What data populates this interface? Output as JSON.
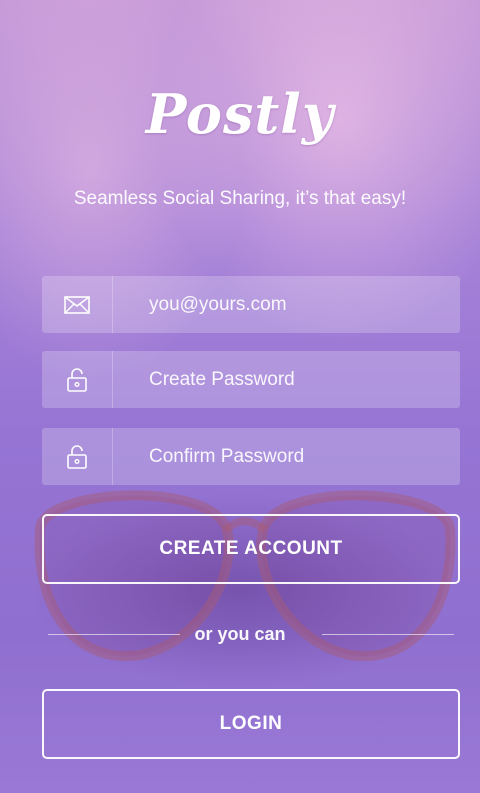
{
  "app": {
    "name": "Postly",
    "tagline": "Seamless Social Sharing, it’s that easy!"
  },
  "form": {
    "email_placeholder": "you@yours.com",
    "password_placeholder": "Create Password",
    "confirm_placeholder": "Confirm Password",
    "email_icon": "envelope-icon",
    "password_icon": "unlock-icon"
  },
  "actions": {
    "create_account_label": "CREATE ACCOUNT",
    "separator_label": "or you can",
    "login_label": "LOGIN"
  }
}
